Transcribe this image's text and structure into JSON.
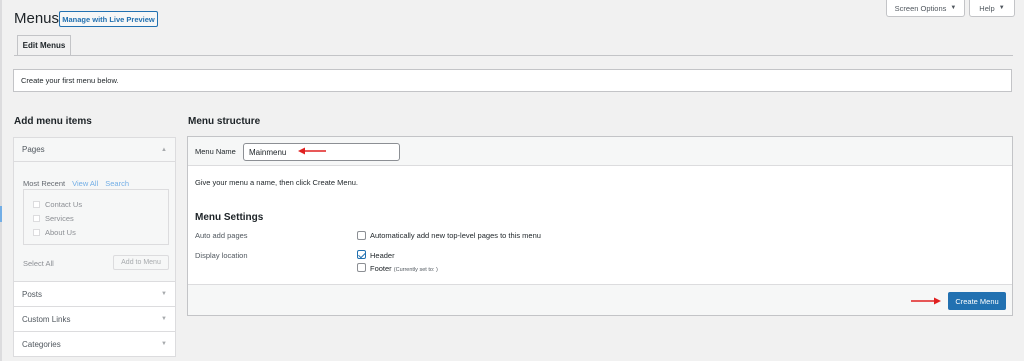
{
  "header": {
    "title": "Menus",
    "live_preview_label": "Manage with Live Preview",
    "screen_options_label": "Screen Options",
    "help_label": "Help"
  },
  "tabs": [
    {
      "label": "Edit Menus"
    }
  ],
  "notice": {
    "text": "Create your first menu below."
  },
  "add_items": {
    "title": "Add menu items",
    "pages": {
      "label": "Pages",
      "tabs": [
        "Most Recent",
        "View All",
        "Search"
      ],
      "items": [
        "Contact Us",
        "Services",
        "About Us"
      ],
      "select_all_label": "Select All",
      "add_button_label": "Add to Menu"
    },
    "sections": [
      "Posts",
      "Custom Links",
      "Categories"
    ]
  },
  "menu_structure": {
    "title": "Menu structure",
    "name_label": "Menu Name",
    "name_value": "Mainmenu",
    "hint": "Give your menu a name, then click Create Menu.",
    "settings_title": "Menu Settings",
    "auto_add_label": "Auto add pages",
    "auto_add_option": "Automatically add new top-level pages to this menu",
    "display_location_label": "Display location",
    "locations": [
      {
        "label": "Header",
        "checked": true,
        "note": ""
      },
      {
        "label": "Footer",
        "checked": false,
        "note": "(Currently set to: )"
      }
    ],
    "create_button_label": "Create Menu"
  },
  "colors": {
    "accent": "#2271b1",
    "annotation_arrow": "#e02020"
  }
}
